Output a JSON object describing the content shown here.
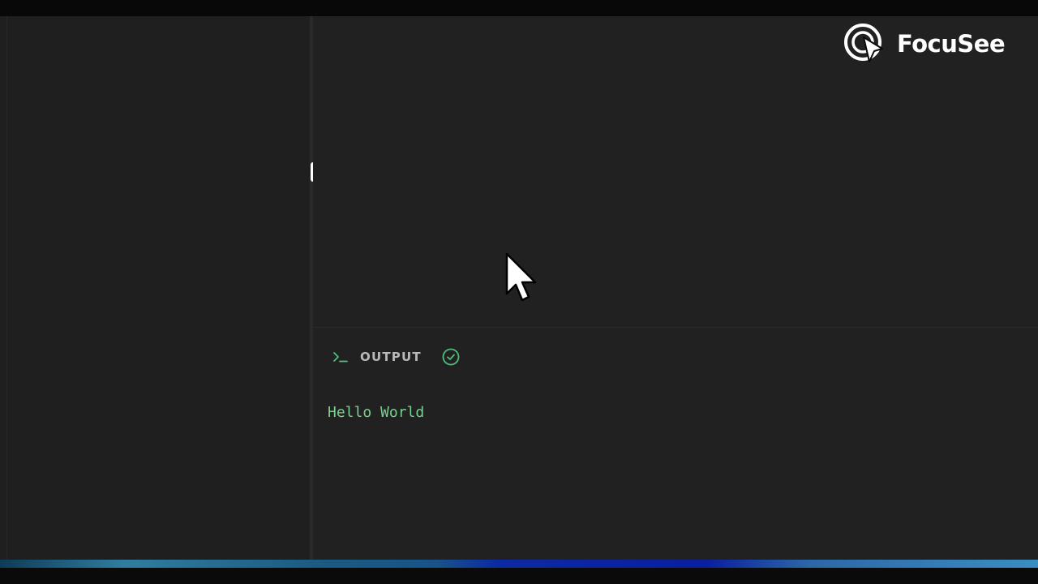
{
  "watermark": {
    "brand": "FocuSee",
    "mark_icon": "focusee-logo-icon",
    "color": "#ffffff"
  },
  "output_panel": {
    "icon": "terminal-icon",
    "title": "OUTPUT",
    "status_icon": "check-circle-icon",
    "status_color": "#4fbf7c",
    "text": "Hello World",
    "text_color": "#7ad08f"
  },
  "editor": {
    "background": "#212121"
  },
  "pointer": {
    "icon": "mouse-cursor-icon"
  }
}
